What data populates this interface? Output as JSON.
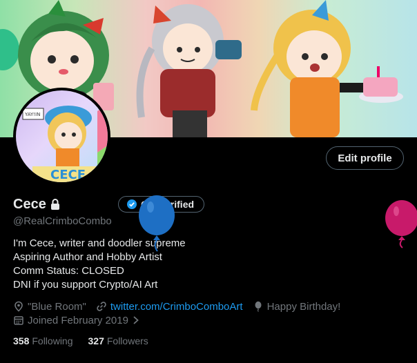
{
  "profile": {
    "name": "Cece",
    "handle": "@RealCrimboCombo",
    "edit_label": "Edit profile",
    "verify_label": "Get verified",
    "bio": [
      "I'm Cece, writer and doodler supreme",
      "Aspiring Author and Hobby Artist",
      "Comm Status: CLOSED",
      "DNI if you support Crypto/AI Art"
    ],
    "location": "\"Blue Room\"",
    "website": "twitter.com/CrimboComboArt",
    "birthday": "Happy Birthday!",
    "joined": "Joined February 2019",
    "following_count": "358",
    "following_label": "Following",
    "followers_count": "327",
    "followers_label": "Followers"
  },
  "avatar_art": {
    "sign_text": "YAY!IN",
    "letters_text": "CECE"
  },
  "colors": {
    "accent": "#1d9bf0",
    "muted": "#71767b",
    "text": "#e7e9ea",
    "border": "#536471",
    "balloon_blue": "#1e6fc4",
    "balloon_pink": "#c81a6a",
    "balloon_green": "#2fbf8a"
  },
  "icons": [
    "lock-icon",
    "verified-badge-icon",
    "location-icon",
    "link-icon",
    "balloon-icon",
    "calendar-icon",
    "chevron-right-icon"
  ]
}
